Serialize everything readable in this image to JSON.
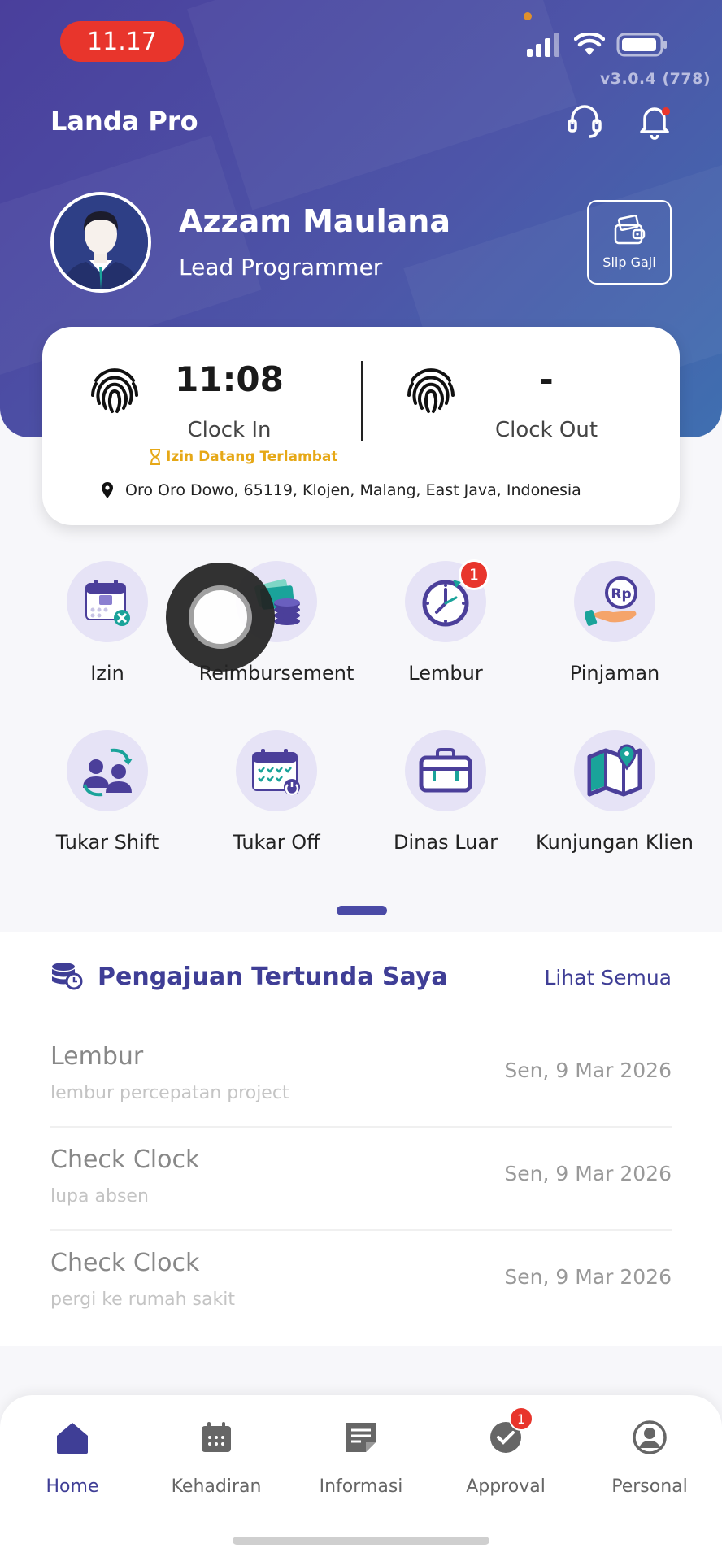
{
  "status_bar": {
    "time": "11.17",
    "version": "v3.0.4 (778)"
  },
  "app": {
    "title": "Landa Pro"
  },
  "profile": {
    "name": "Azzam Maulana",
    "role": "Lead Programmer",
    "slip_label": "Slip Gaji"
  },
  "clock": {
    "in_time": "11:08",
    "in_label": "Clock In",
    "out_time": "-",
    "out_label": "Clock Out",
    "late_note": "Izin Datang Terlambat",
    "location": "Oro Oro Dowo, 65119, Klojen, Malang, East Java, Indonesia"
  },
  "menu": [
    {
      "label": "Izin",
      "icon": "calendar-cancel-icon"
    },
    {
      "label": "Reimbursement",
      "icon": "money-coins-icon"
    },
    {
      "label": "Lembur",
      "icon": "clock-icon",
      "badge": "1"
    },
    {
      "label": "Pinjaman",
      "icon": "loan-hand-icon"
    },
    {
      "label": "Tukar Shift",
      "icon": "swap-users-icon"
    },
    {
      "label": "Tukar Off",
      "icon": "calendar-check-icon"
    },
    {
      "label": "Dinas Luar",
      "icon": "briefcase-icon"
    },
    {
      "label": "Kunjungan Klien",
      "icon": "map-pin-icon"
    }
  ],
  "pending": {
    "title": "Pengajuan Tertunda Saya",
    "see_all": "Lihat Semua",
    "items": [
      {
        "title": "Lembur",
        "subtitle": "lembur percepatan project",
        "date": "Sen, 9 Mar 2026"
      },
      {
        "title": "Check Clock",
        "subtitle": "lupa absen",
        "date": "Sen, 9 Mar 2026"
      },
      {
        "title": "Check Clock",
        "subtitle": "pergi ke rumah sakit",
        "date": "Sen, 9 Mar 2026"
      }
    ]
  },
  "nav": [
    {
      "label": "Home",
      "icon": "home-icon",
      "active": true
    },
    {
      "label": "Kehadiran",
      "icon": "calendar-icon"
    },
    {
      "label": "Informasi",
      "icon": "document-icon"
    },
    {
      "label": "Approval",
      "icon": "approval-check-icon",
      "badge": "1"
    },
    {
      "label": "Personal",
      "icon": "user-circle-icon"
    }
  ],
  "colors": {
    "primary": "#3f3e96",
    "header_start": "#4a3f9c",
    "header_end": "#3f6fb0",
    "badge": "#e8352c",
    "late": "#e6a817"
  }
}
